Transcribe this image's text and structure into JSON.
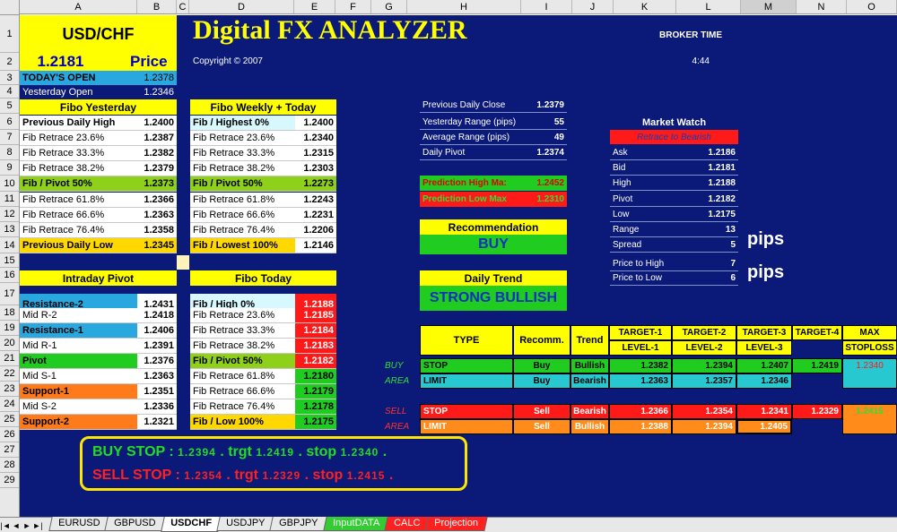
{
  "columns": [
    "A",
    "B",
    "C",
    "D",
    "E",
    "F",
    "G",
    "H",
    "I",
    "J",
    "K",
    "L",
    "M",
    "N",
    "O"
  ],
  "selected_column": "M",
  "rows": [
    "1",
    "2",
    "3",
    "4",
    "5",
    "6",
    "7",
    "8",
    "9",
    "10",
    "11",
    "12",
    "13",
    "14",
    "15",
    "16",
    "17",
    "18",
    "19",
    "20",
    "21",
    "22",
    "23",
    "24",
    "25",
    "26",
    "27",
    "28",
    "29"
  ],
  "header": {
    "pair": "USD/CHF",
    "price": "1.2181",
    "price_label": "Price",
    "title": "Digital  FX ANALYZER",
    "copyright": "Copyright © 2007",
    "broker_time_label": "BROKER TIME",
    "broker_time": "4:44"
  },
  "opens": {
    "todays_open_label": "TODAY'S OPEN",
    "todays_open": "1.2378",
    "yesterday_open_label": "Yesterday Open",
    "yesterday_open": "1.2346"
  },
  "fibo_yesterday": {
    "title": "Fibo Yesterday",
    "rows": [
      {
        "label": "Previous Daily High",
        "value": "1.2400"
      },
      {
        "label": "Fib Retrace 23.6%",
        "value": "1.2387"
      },
      {
        "label": "Fib Retrace 33.3%",
        "value": "1.2382"
      },
      {
        "label": "Fib Retrace 38.2%",
        "value": "1.2379"
      },
      {
        "label": "Fib / Pivot 50%",
        "value": "1.2373"
      },
      {
        "label": "Fib Retrace 61.8%",
        "value": "1.2366"
      },
      {
        "label": "Fib Retrace 66.6%",
        "value": "1.2363"
      },
      {
        "label": "Fib Retrace 76.4%",
        "value": "1.2358"
      },
      {
        "label": "Previous Daily Low",
        "value": "1.2345"
      }
    ]
  },
  "fibo_weekly": {
    "title": "Fibo Weekly + Today",
    "rows": [
      {
        "label": "Fib / Highest 0%",
        "value": "1.2400"
      },
      {
        "label": "Fib Retrace 23.6%",
        "value": "1.2340"
      },
      {
        "label": "Fib Retrace 33.3%",
        "value": "1.2315"
      },
      {
        "label": "Fib Retrace 38.2%",
        "value": "1.2303"
      },
      {
        "label": "Fib / Pivot 50%",
        "value": "1.2273"
      },
      {
        "label": "Fib Retrace 61.8%",
        "value": "1.2243"
      },
      {
        "label": "Fib Retrace 66.6%",
        "value": "1.2231"
      },
      {
        "label": "Fib Retrace 76.4%",
        "value": "1.2206"
      },
      {
        "label": "Fib / Lowest 100%",
        "value": "1.2146"
      }
    ]
  },
  "intraday_pivot": {
    "title": "Intraday Pivot",
    "rows": [
      {
        "label": "Resistance-2",
        "value": "1.2431"
      },
      {
        "label": "Mid R-2",
        "value": "1.2418"
      },
      {
        "label": "Resistance-1",
        "value": "1.2406"
      },
      {
        "label": "Mid R-1",
        "value": "1.2391"
      },
      {
        "label": "Pivot",
        "value": "1.2376"
      },
      {
        "label": "Mid S-1",
        "value": "1.2363"
      },
      {
        "label": "Support-1",
        "value": "1.2351"
      },
      {
        "label": "Mid S-2",
        "value": "1.2336"
      },
      {
        "label": "Support-2",
        "value": "1.2321"
      }
    ]
  },
  "fibo_today": {
    "title": "Fibo Today",
    "rows": [
      {
        "label": "Fib / High 0%",
        "value": "1.2188"
      },
      {
        "label": "Fib Retrace 23.6%",
        "value": "1.2185"
      },
      {
        "label": "Fib Retrace 33.3%",
        "value": "1.2184"
      },
      {
        "label": "Fib Retrace 38.2%",
        "value": "1.2183"
      },
      {
        "label": "Fib / Pivot 50%",
        "value": "1.2182"
      },
      {
        "label": "Fib Retrace 61.8%",
        "value": "1.2180"
      },
      {
        "label": "Fib Retrace 66.6%",
        "value": "1.2179"
      },
      {
        "label": "Fib Retrace 76.4%",
        "value": "1.2178"
      },
      {
        "label": "Fib / Low 100%",
        "value": "1.2175"
      }
    ]
  },
  "stats": [
    {
      "label": "Previous Daily Close",
      "value": "1.2379"
    },
    {
      "label": "Yesterday Range (pips)",
      "value": "55"
    },
    {
      "label": "Average Range (pips)",
      "value": "49"
    },
    {
      "label": "Daily Pivot",
      "value": "1.2374"
    }
  ],
  "predictions": {
    "high_label": "Prediction High Ma:",
    "high": "1.2452",
    "low_label": "Prediction Low Max",
    "low": "1.2310"
  },
  "recommendation": {
    "title": "Recommendation",
    "value": "BUY"
  },
  "daily_trend": {
    "title": "Daily Trend",
    "value": "STRONG BULLISH"
  },
  "market_watch": {
    "title": "Market Watch",
    "status": "Retrace to Bearish",
    "rows": [
      {
        "label": "Ask",
        "value": "1.2186"
      },
      {
        "label": "Bid",
        "value": "1.2181"
      },
      {
        "label": "High",
        "value": "1.2188"
      },
      {
        "label": "Pivot",
        "value": "1.2182"
      },
      {
        "label": "Low",
        "value": "1.2175"
      },
      {
        "label": "Range",
        "value": "13"
      },
      {
        "label": "Spread",
        "value": "5"
      },
      {
        "label": "Price to High",
        "value": "7"
      },
      {
        "label": "Price to Low",
        "value": "6"
      }
    ],
    "pips_label": "pips"
  },
  "targets": {
    "headers": {
      "type": "TYPE",
      "recomm": "Recomm.",
      "trend": "Trend",
      "t1": "TARGET-1",
      "t1b": "LEVEL-1",
      "t2": "TARGET-2",
      "t2b": "LEVEL-2",
      "t3": "TARGET-3",
      "t3b": "LEVEL-3",
      "t4": "TARGET-4",
      "max": "MAX",
      "maxb": "STOPLOSS"
    },
    "buy_area": {
      "label1": "BUY",
      "label2": "AREA"
    },
    "sell_area": {
      "label1": "SELL",
      "label2": "AREA"
    },
    "rows": [
      {
        "type": "STOP",
        "recomm": "Buy",
        "trend": "Bullish",
        "t1": "1.2382",
        "t2": "1.2394",
        "t3": "1.2407",
        "t4": "1.2419",
        "max": "1.2340"
      },
      {
        "type": "LIMIT",
        "recomm": "Buy",
        "trend": "Bearish",
        "t1": "1.2363",
        "t2": "1.2357",
        "t3": "1.2346",
        "t4": "",
        "max": ""
      },
      {
        "type": "STOP",
        "recomm": "Sell",
        "trend": "Bearish",
        "t1": "1.2366",
        "t2": "1.2354",
        "t3": "1.2341",
        "t4": "1.2329",
        "max": "1.2415"
      },
      {
        "type": "LIMIT",
        "recomm": "Sell",
        "trend": "Bullish",
        "t1": "1.2388",
        "t2": "1.2394",
        "t3": "1.2405",
        "t4": "",
        "max": ""
      }
    ]
  },
  "summary": {
    "buy_label": "BUY STOP :",
    "buy_price": "1.2394",
    "sell_label": "SELL STOP :",
    "sell_price": "1.2354",
    "trgt": "trgt",
    "stop": "stop",
    "buy_trgt": "1.2419",
    "buy_stop": "1.2340",
    "sell_trgt": "1.2329",
    "sell_stop": "1.2415",
    "dot": "."
  },
  "tabs": [
    {
      "label": "EURUSD",
      "active": false,
      "color": "#e8e8e8"
    },
    {
      "label": "GBPUSD",
      "active": false,
      "color": "#e8e8e8"
    },
    {
      "label": "USDCHF",
      "active": true,
      "color": "#ffffff"
    },
    {
      "label": "USDJPY",
      "active": false,
      "color": "#e8e8e8"
    },
    {
      "label": "GBPJPY",
      "active": false,
      "color": "#e8e8e8"
    },
    {
      "label": "InputDATA",
      "active": false,
      "color": "#33cc33"
    },
    {
      "label": "CALC",
      "active": false,
      "color": "#ff2020"
    },
    {
      "label": "Projection",
      "active": false,
      "color": "#ff2020"
    }
  ],
  "tab_nav": [
    "first-sheet-icon",
    "prev-sheet-icon",
    "next-sheet-icon",
    "last-sheet-icon"
  ]
}
